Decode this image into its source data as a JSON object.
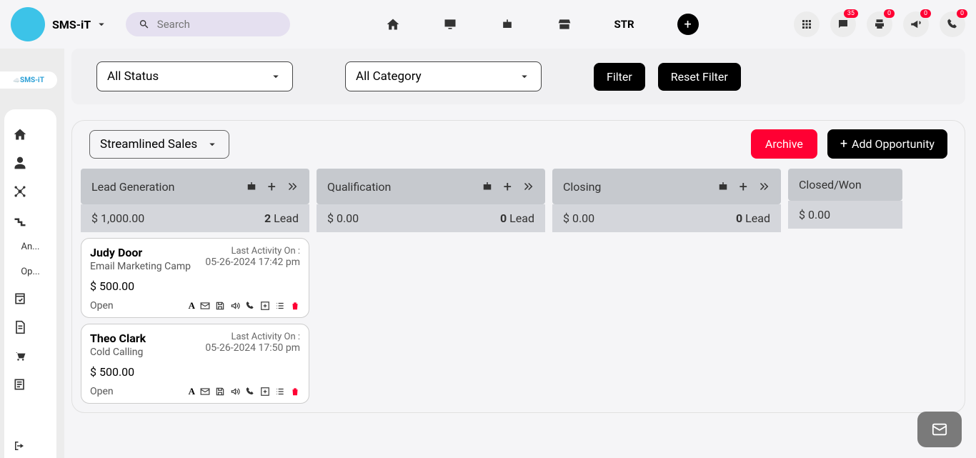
{
  "brand": "SMS-iT",
  "search": {
    "placeholder": "Search"
  },
  "topnav": {
    "str": "STR"
  },
  "badges": {
    "chat": "35",
    "print": "0",
    "ann": "0",
    "phone": "0"
  },
  "sidebar": {
    "logo": "SMS-iT",
    "items": [
      "An...",
      "Op..."
    ]
  },
  "filters": {
    "status": "All Status",
    "category": "All Category",
    "filter_btn": "Filter",
    "reset_btn": "Reset Filter"
  },
  "pipeline": "Streamlined Sales",
  "actions": {
    "archive": "Archive",
    "add": "Add Opportunity"
  },
  "columns": [
    {
      "title": "Lead Generation",
      "total": "$ 1,000.00",
      "count": "2",
      "count_label": " Lead",
      "cards": [
        {
          "name": "Judy Door",
          "sub": "Email Marketing Camp",
          "activity_label": "Last Activity On :",
          "activity": "05-26-2024 17:42 pm",
          "amount": "$ 500.00",
          "status": "Open"
        },
        {
          "name": "Theo Clark",
          "sub": "Cold Calling",
          "activity_label": "Last Activity On :",
          "activity": "05-26-2024 17:50 pm",
          "amount": "$ 500.00",
          "status": "Open"
        }
      ]
    },
    {
      "title": "Qualification",
      "total": "$ 0.00",
      "count": "0",
      "count_label": " Lead",
      "cards": []
    },
    {
      "title": "Closing",
      "total": "$ 0.00",
      "count": "0",
      "count_label": " Lead",
      "cards": []
    },
    {
      "title": "Closed/Won",
      "total": "$ 0.00",
      "count": "",
      "count_label": "",
      "cards": []
    }
  ]
}
